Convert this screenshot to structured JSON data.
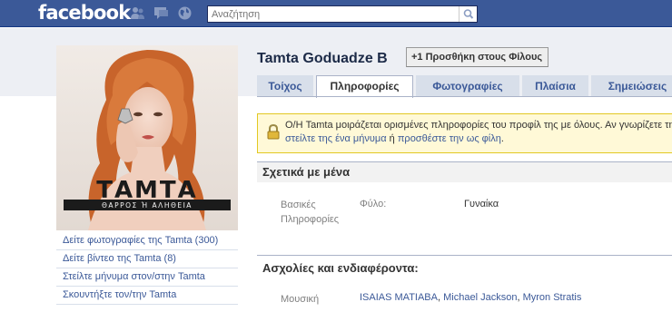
{
  "topbar": {
    "logo": "facebook",
    "search": {
      "placeholder": "Αναζήτηση"
    }
  },
  "profile": {
    "name": "Tamta Goduadze B",
    "add_friend": "+1 Προσθήκη στους Φίλους",
    "picture": {
      "title": "ΤΑΜΤΑ",
      "subtitle": "ΘΑΡΡΟΣ Ή ΑΛΗΘΕΙΑ"
    }
  },
  "left_links": [
    "Δείτε φωτογραφίες της Tamta (300)",
    "Δείτε βίντεο της Tamta (8)",
    "Στείλτε μήνυμα στον/στην Tamta",
    "Σκουντήξτε τον/την Tamta"
  ],
  "tabs": [
    "Τοίχος",
    "Πληροφορίες",
    "Φωτογραφίες",
    "Πλαίσια",
    "Σημειώσεις"
  ],
  "active_tab": "Πληροφορίες",
  "notice": {
    "line1": "Ο/Η Tamta μοιράζεται ορισμένες πληροφορίες του προφίλ της με όλους. Αν γνωρίζετε την",
    "message_link": "στείλτε της ένα μήνυμα",
    "or": " ή ",
    "add_link": "προσθέστε την ως φίλη",
    "end": "."
  },
  "about": {
    "title": "Σχετικά με μένα",
    "basic_label": "Βασικές Πληροφορίες",
    "gender_field": "Φύλο:",
    "gender_value": "Γυναίκα"
  },
  "interests": {
    "title": "Ασχολίες και ενδιαφέροντα:",
    "music_label": "Μουσική",
    "music_items": [
      "ISAIAS MATIABA",
      "Michael Jackson",
      "Myron Stratis"
    ]
  },
  "colors": {
    "brand": "#3b5998",
    "link": "#3b5998",
    "notice_bg": "#fff9d7",
    "notice_border": "#e2c822"
  },
  "icons": [
    "friends-icon",
    "messages-icon",
    "notifications-globe-icon",
    "search-icon",
    "lock-icon"
  ]
}
